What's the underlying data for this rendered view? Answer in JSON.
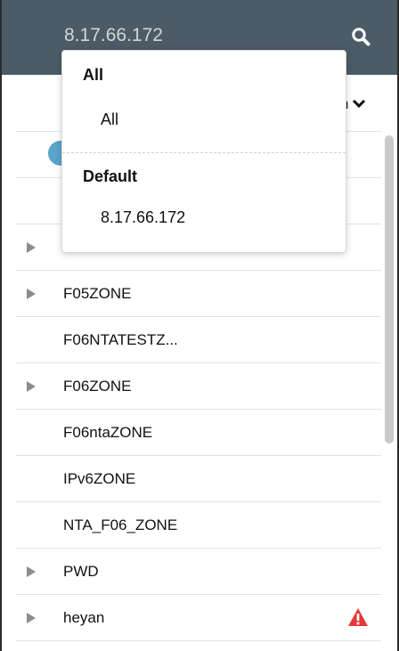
{
  "search": {
    "value": "8.17.66.172"
  },
  "sort": {
    "label_fragment": "n"
  },
  "suggestions": {
    "groups": [
      {
        "title": "All",
        "options": [
          "All"
        ]
      },
      {
        "title": "Default",
        "options": [
          "8.17.66.172"
        ]
      }
    ]
  },
  "list": {
    "rows": [
      {
        "label": "",
        "expandable": false,
        "warning": false
      },
      {
        "label": "",
        "expandable": true,
        "warning": false
      },
      {
        "label": "F05ZONE",
        "expandable": true,
        "warning": false
      },
      {
        "label": "F06NTATESTZ...",
        "expandable": false,
        "warning": false
      },
      {
        "label": "F06ZONE",
        "expandable": true,
        "warning": false
      },
      {
        "label": "F06ntaZONE",
        "expandable": false,
        "warning": false
      },
      {
        "label": "IPv6ZONE",
        "expandable": false,
        "warning": false
      },
      {
        "label": "NTA_F06_ZONE",
        "expandable": false,
        "warning": false
      },
      {
        "label": "PWD",
        "expandable": true,
        "warning": false
      },
      {
        "label": "heyan",
        "expandable": true,
        "warning": true
      }
    ]
  },
  "colors": {
    "header_bg": "#4d5b66",
    "warning": "#e53935",
    "status_dot": "#5aa3c9"
  },
  "icons": {
    "search": "search-icon",
    "sort_chevron": "chevron-down-icon",
    "expand": "caret-right-icon",
    "warning": "warning-triangle-icon"
  }
}
